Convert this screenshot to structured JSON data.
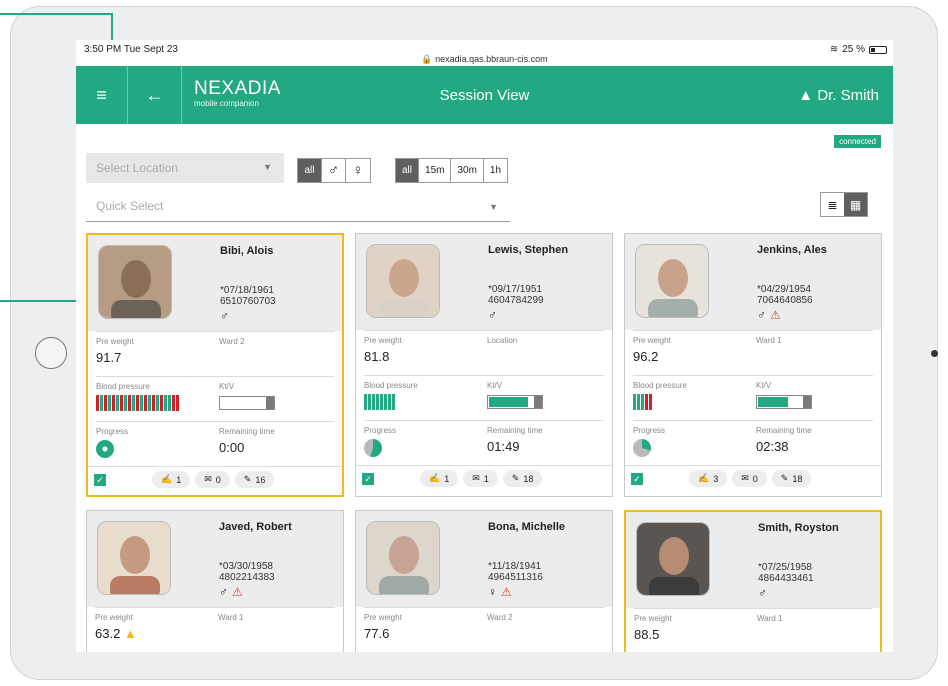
{
  "status": {
    "time": "3:50 PM  Tue Sept 23",
    "url": "nexadia.qas.bbraun-cis.com",
    "battery": "25 %"
  },
  "appbar": {
    "brand": "NEXADIA",
    "subtitle": "mobile companion",
    "title": "Session View",
    "user": "Dr. Smith"
  },
  "connection": "connected",
  "filters": {
    "location_placeholder": "Select Location",
    "quick_placeholder": "Quick Select",
    "gender": [
      "all",
      "♂",
      "♀"
    ],
    "time": [
      "all",
      "15m",
      "30m",
      "1h"
    ]
  },
  "labels": {
    "pre_weight": "Pre weight",
    "blood_pressure": "Blood pressure",
    "ktv": "Kt/V",
    "progress": "Progress",
    "remaining": "Remaining time"
  },
  "patients": [
    {
      "name": "Bibi, Alois",
      "dob": "*07/18/1961",
      "id": "6510760703",
      "gender": "♂",
      "warning": false,
      "weight": "91.7",
      "weight_warn": false,
      "location": "Ward 2",
      "bp_bars": [
        "r",
        "g",
        "r",
        "g",
        "r",
        "g",
        "r",
        "g",
        "r",
        "g",
        "r",
        "g",
        "r",
        "g",
        "r",
        "g",
        "r",
        "g",
        "g",
        "r",
        "r"
      ],
      "ktv_fill": 0.0,
      "progress": 0.02,
      "remaining": "0:00",
      "notes": "1",
      "messages": "0",
      "docs": "16"
    },
    {
      "name": "Lewis, Stephen",
      "dob": "*09/17/1951",
      "id": "4604784299",
      "gender": "♂",
      "warning": false,
      "weight": "81.8",
      "weight_warn": false,
      "location": "Location",
      "bp_bars": [
        "g",
        "g",
        "g",
        "g",
        "g",
        "g",
        "g",
        "g"
      ],
      "ktv_fill": 0.85,
      "progress": 0.55,
      "remaining": "01:49",
      "notes": "1",
      "messages": "1",
      "docs": "18"
    },
    {
      "name": "Jenkins, Ales",
      "dob": "*04/29/1954",
      "id": "7064640856",
      "gender": "♂",
      "warning": true,
      "weight": "96.2",
      "weight_warn": false,
      "location": "Ward 1",
      "bp_bars": [
        "g",
        "g",
        "g",
        "r",
        "r"
      ],
      "ktv_fill": 0.65,
      "progress": 0.3,
      "remaining": "02:38",
      "notes": "3",
      "messages": "0",
      "docs": "18"
    },
    {
      "name": "Javed, Robert",
      "dob": "*03/30/1958",
      "id": "4802214383",
      "gender": "♂",
      "warning": true,
      "weight": "63.2",
      "weight_warn": true,
      "location": "Ward 1"
    },
    {
      "name": "Bona, Michelle",
      "dob": "*11/18/1941",
      "id": "4964511316",
      "gender": "♀",
      "warning": true,
      "weight": "77.6",
      "weight_warn": false,
      "location": "Ward 2"
    },
    {
      "name": "Smith, Royston",
      "dob": "*07/25/1958",
      "id": "4864433461",
      "gender": "♂",
      "warning": false,
      "weight": "88.5",
      "weight_warn": false,
      "location": "Ward 1"
    }
  ],
  "colors": {
    "accent": "#22a882",
    "highlight": "#f3b81e",
    "bp_red": "#d0202a",
    "bp_green": "#22a882"
  }
}
